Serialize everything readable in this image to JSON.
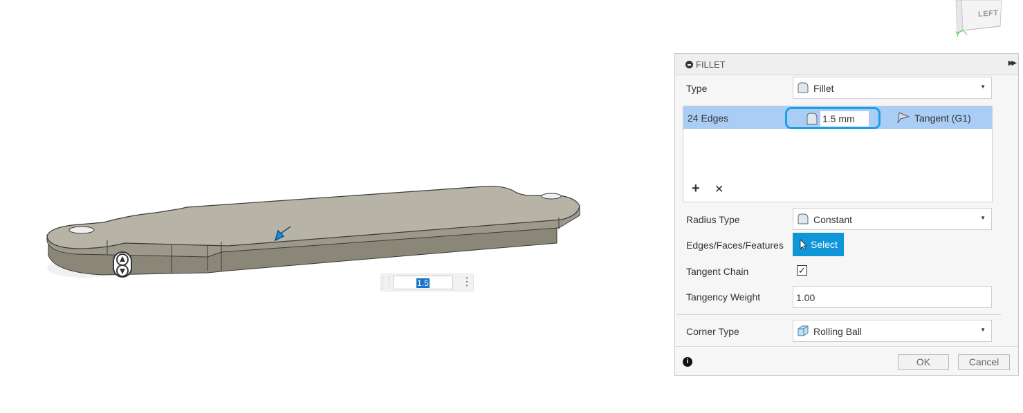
{
  "viewcube": {
    "face_label": "LEFT",
    "axis_label": "Y"
  },
  "viewport": {
    "input_value": "1.5"
  },
  "fillet_panel": {
    "title": "FILLET",
    "type": {
      "label": "Type",
      "value": "Fillet"
    },
    "edges": {
      "label": "24 Edges",
      "radius": "1.5 mm",
      "continuity": "Tangent (G1)"
    },
    "radius_type": {
      "label": "Radius Type",
      "value": "Constant"
    },
    "edges_faces_features": {
      "label": "Edges/Faces/Features",
      "button": "Select"
    },
    "tangent_chain": {
      "label": "Tangent Chain",
      "checked": true,
      "mark": "✓"
    },
    "tangency_weight": {
      "label": "Tangency Weight",
      "value": "1.00"
    },
    "corner_type": {
      "label": "Corner Type",
      "value": "Rolling Ball"
    },
    "ok_label": "OK",
    "cancel_label": "Cancel",
    "info_glyph": "i"
  },
  "colors": {
    "accent": "#0e96d8",
    "selection_row": "#a9cdf5",
    "radius_outline": "#1aa0e8"
  }
}
